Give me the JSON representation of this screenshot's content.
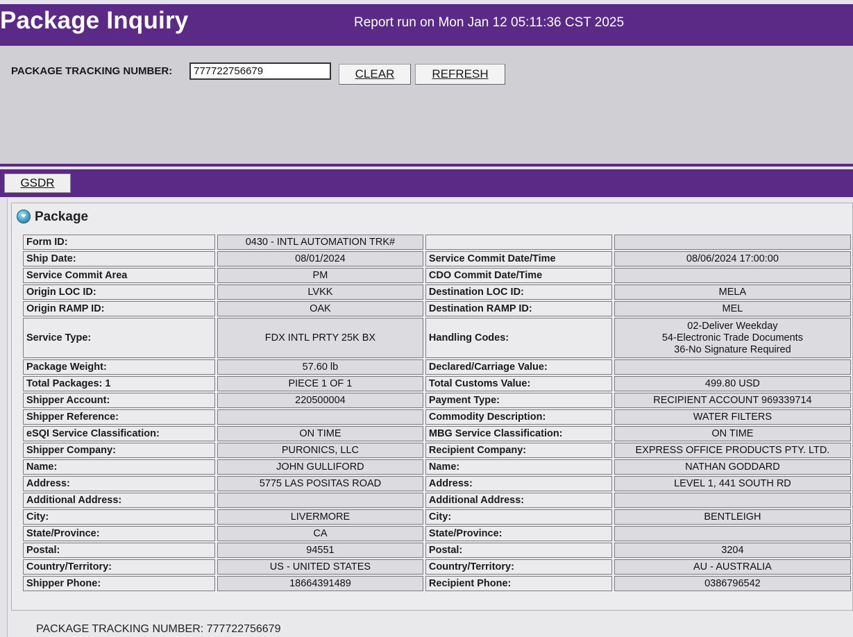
{
  "header": {
    "title": "Package Inquiry",
    "report_run": "Report run on Mon Jan 12 05:11:36 CST 2025"
  },
  "search": {
    "label": "PACKAGE TRACKING NUMBER:",
    "value": "777722756679",
    "clear_label": "CLEAR",
    "refresh_label": "REFRESH"
  },
  "tabs": {
    "gsdr": "GSDR"
  },
  "section": {
    "title": "Package"
  },
  "rows": [
    {
      "l1": "Form ID:",
      "v1": "0430 - INTL AUTOMATION TRK#",
      "l2": "",
      "v2": ""
    },
    {
      "l1": "Ship Date:",
      "v1": "08/01/2024",
      "l2": "Service Commit Date/Time",
      "v2": "08/06/2024 17:00:00"
    },
    {
      "l1": "Service Commit Area",
      "v1": "PM",
      "l2": "CDO Commit Date/Time",
      "v2": ""
    },
    {
      "l1": "Origin LOC ID:",
      "v1": "LVKK",
      "l2": "Destination LOC ID:",
      "v2": "MELA"
    },
    {
      "l1": "Origin RAMP ID:",
      "v1": "OAK",
      "l2": "Destination RAMP ID:",
      "v2": "MEL"
    },
    {
      "l1": "Service Type:",
      "v1": "FDX INTL PRTY 25K BX",
      "l2": "Handling Codes:",
      "v2a": "02-Deliver Weekday",
      "v2b": "54-Electronic Trade Documents",
      "v2c": "36-No Signature Required"
    },
    {
      "l1": "Package Weight:",
      "v1": "57.60 lb",
      "l2": "Declared/Carriage Value:",
      "v2": ""
    },
    {
      "l1": "Total Packages: 1",
      "v1": "PIECE 1 OF 1",
      "l2": "Total Customs Value:",
      "v2": "499.80 USD"
    },
    {
      "l1": "Shipper Account:",
      "v1": "220500004",
      "l2": "Payment Type:",
      "v2": "RECIPIENT ACCOUNT 969339714"
    },
    {
      "l1": "Shipper Reference:",
      "v1": "",
      "l2": "Commodity Description:",
      "v2": "WATER FILTERS"
    },
    {
      "l1": "eSQI Service Classification:",
      "v1": "ON TIME",
      "l2": "MBG Service Classification:",
      "v2": "ON TIME"
    },
    {
      "l1": "Shipper Company:",
      "v1": "PURONICS, LLC",
      "l2": "Recipient Company:",
      "v2": "EXPRESS OFFICE PRODUCTS PTY. LTD."
    },
    {
      "l1": "Name:",
      "v1": "JOHN GULLIFORD",
      "l2": "Name:",
      "v2": "NATHAN GODDARD"
    },
    {
      "l1": "Address:",
      "v1": "5775 LAS POSITAS ROAD",
      "l2": "Address:",
      "v2": "LEVEL 1, 441 SOUTH RD"
    },
    {
      "l1": "Additional Address:",
      "v1": "",
      "l2": "Additional Address:",
      "v2": ""
    },
    {
      "l1": "City:",
      "v1": "LIVERMORE",
      "l2": "City:",
      "v2": "BENTLEIGH"
    },
    {
      "l1": "State/Province:",
      "v1": "CA",
      "l2": "State/Province:",
      "v2": ""
    },
    {
      "l1": "Postal:",
      "v1": "94551",
      "l2": "Postal:",
      "v2": "3204"
    },
    {
      "l1": "Country/Territory:",
      "v1": "US - UNITED STATES",
      "l2": "Country/Territory:",
      "v2": "AU - AUSTRALIA"
    },
    {
      "l1": "Shipper Phone:",
      "v1": "18664391489",
      "l2": "Recipient Phone:",
      "v2": "0386796542"
    }
  ],
  "footer": {
    "tracking_label": "PACKAGE TRACKING NUMBER:",
    "tracking_value": "777722756679"
  },
  "colors": {
    "brand_purple": "#5a2a86",
    "search_bar_bg": "#cfcfd4"
  },
  "icons": {
    "expand": "expand-collapse-circle-icon"
  }
}
